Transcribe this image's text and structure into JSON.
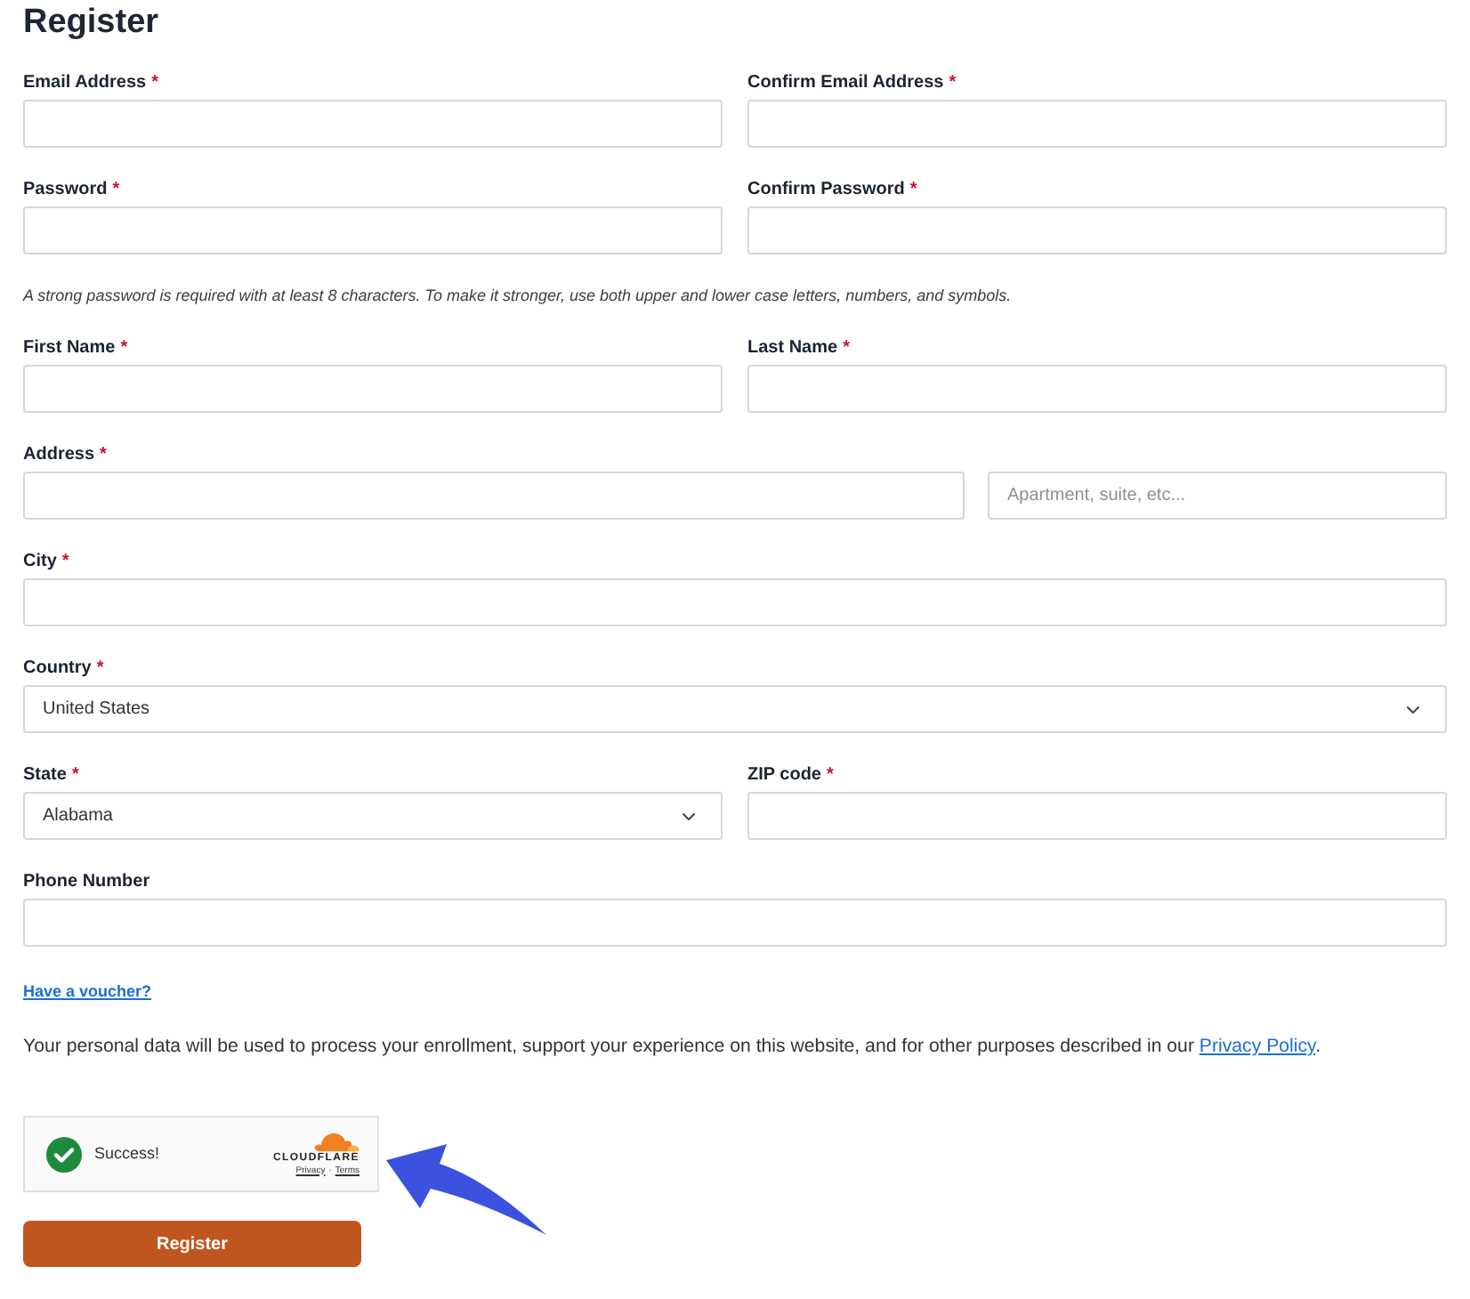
{
  "title": "Register",
  "rows": [
    {
      "kind": "pair",
      "fields": [
        {
          "kind": "input",
          "label": "Email Address",
          "required_mark": "*"
        },
        {
          "kind": "input",
          "label": "Confirm Email Address",
          "required_mark": "*"
        }
      ]
    },
    {
      "kind": "pair",
      "fields": [
        {
          "kind": "input",
          "label": "Password",
          "required_mark": "*"
        },
        {
          "kind": "input",
          "label": "Confirm Password",
          "required_mark": "*"
        }
      ]
    },
    {
      "kind": "hint",
      "text": "A strong password is required with at least 8 characters. To make it stronger, use both upper and lower case letters, numbers, and symbols."
    },
    {
      "kind": "pair",
      "fields": [
        {
          "kind": "input",
          "label": "First Name",
          "required_mark": "*"
        },
        {
          "kind": "input",
          "label": "Last Name",
          "required_mark": "*"
        }
      ]
    },
    {
      "kind": "address",
      "fields": [
        {
          "kind": "input",
          "label": "Address",
          "required_mark": "*"
        },
        {
          "kind": "input",
          "placeholder": "Apartment, suite, etc..."
        }
      ]
    },
    {
      "kind": "full",
      "fields": [
        {
          "kind": "input",
          "label": "City",
          "required_mark": "*"
        }
      ]
    },
    {
      "kind": "full",
      "fields": [
        {
          "kind": "select",
          "label": "Country",
          "required_mark": "*",
          "value": "United States"
        }
      ]
    },
    {
      "kind": "pair",
      "fields": [
        {
          "kind": "select",
          "label": "State",
          "required_mark": "*",
          "value": "Alabama"
        },
        {
          "kind": "input",
          "label": "ZIP code",
          "required_mark": "*"
        }
      ]
    },
    {
      "kind": "full",
      "fields": [
        {
          "kind": "input",
          "label": "Phone Number"
        }
      ]
    }
  ],
  "voucher_link": "Have a voucher?",
  "privacy_notice": {
    "text": "Your personal data will be used to process your enrollment, support your experience on this website, and for other purposes described in our ",
    "link": "Privacy Policy",
    "end": "."
  },
  "captcha": {
    "status": "Success!",
    "brand": "CLOUDFLARE",
    "links": [
      "Privacy",
      "Terms"
    ],
    "separator": "·"
  },
  "submit_button": "Register"
}
